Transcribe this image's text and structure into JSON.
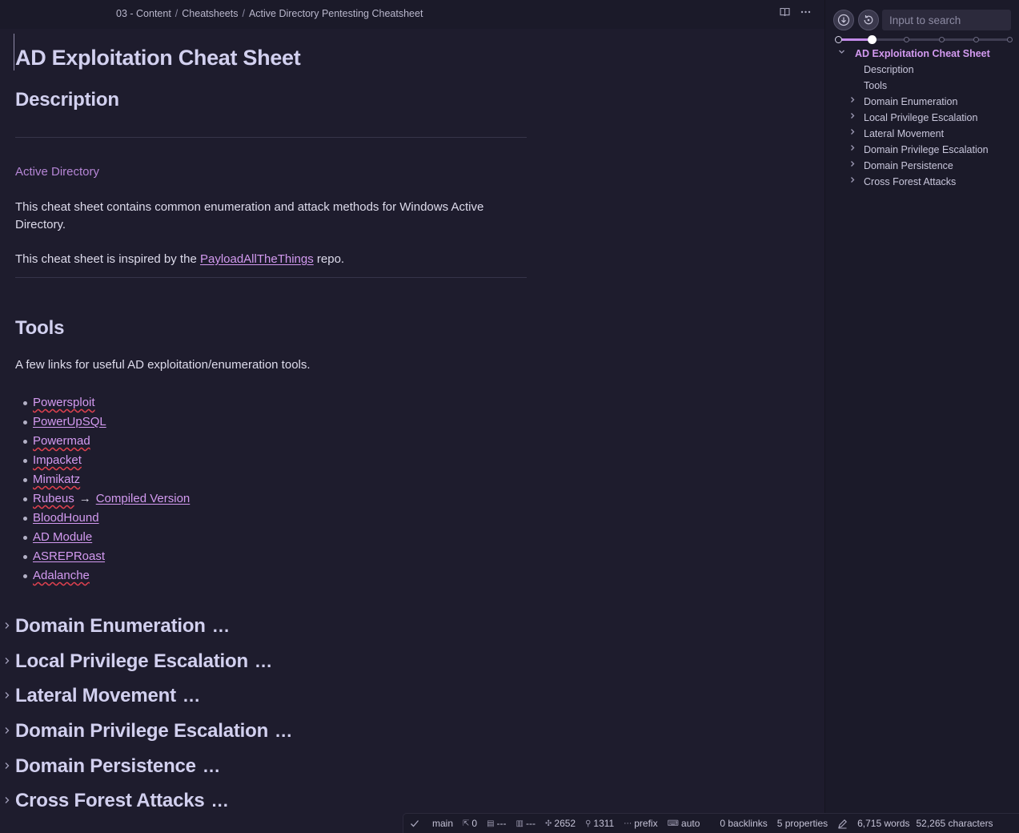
{
  "breadcrumb": [
    "03 - Content",
    "Cheatsheets",
    "Active Directory Pentesting Cheatsheet"
  ],
  "note": {
    "title": "AD Exploitation Cheat Sheet",
    "description_heading": "Description",
    "tag": "Active Directory",
    "para1": "This cheat sheet contains common enumeration and attack methods for Windows Active Directory.",
    "para2_prefix": "This cheat sheet is inspired by the ",
    "para2_link": "PayloadAllTheThings",
    "para2_suffix": " repo.",
    "tools_heading": "Tools",
    "tools_intro": "A few links for useful AD exploitation/enumeration tools.",
    "tools": [
      {
        "label": "Powersploit"
      },
      {
        "label": "PowerUpSQL"
      },
      {
        "label": "Powermad"
      },
      {
        "label": "Impacket"
      },
      {
        "label": "Mimikatz"
      },
      {
        "label": "Rubeus",
        "extra": "Compiled Version"
      },
      {
        "label": "BloodHound"
      },
      {
        "label": "AD Module"
      },
      {
        "label": "ASREPRoast"
      },
      {
        "label": "Adalanche"
      }
    ],
    "arrow": "→",
    "folded_ellipsis": "...",
    "folded_sections": [
      "Domain Enumeration",
      "Local Privilege Escalation",
      "Lateral Movement",
      "Domain Privilege Escalation",
      "Domain Persistence",
      "Cross Forest Attacks"
    ]
  },
  "sidebar": {
    "search_placeholder": "Input to search",
    "outline": {
      "root": "AD Exploitation Cheat Sheet",
      "items": [
        {
          "label": "Description",
          "expandable": false
        },
        {
          "label": "Tools",
          "expandable": false
        },
        {
          "label": "Domain Enumeration",
          "expandable": true
        },
        {
          "label": "Local Privilege Escalation",
          "expandable": true
        },
        {
          "label": "Lateral Movement",
          "expandable": true
        },
        {
          "label": "Domain Privilege Escalation",
          "expandable": true
        },
        {
          "label": "Domain Persistence",
          "expandable": true
        },
        {
          "label": "Cross Forest Attacks",
          "expandable": true
        }
      ]
    },
    "heading_level_slider": {
      "levels": 6,
      "selected_level": 2
    }
  },
  "statusbar": {
    "branch": "main",
    "sync_count": "0",
    "commit_info": "---",
    "stats_info": "---",
    "nodes": "2652",
    "links": "1311",
    "prefix": "prefix",
    "auto": "auto",
    "backlinks": "0 backlinks",
    "properties": "5 properties",
    "words": "6,715 words",
    "characters": "52,265 characters"
  },
  "colors": {
    "background": "#1e1c2d",
    "accent": "#d39af0",
    "heading": "#d2d0ef",
    "tag": "#b686d6"
  }
}
